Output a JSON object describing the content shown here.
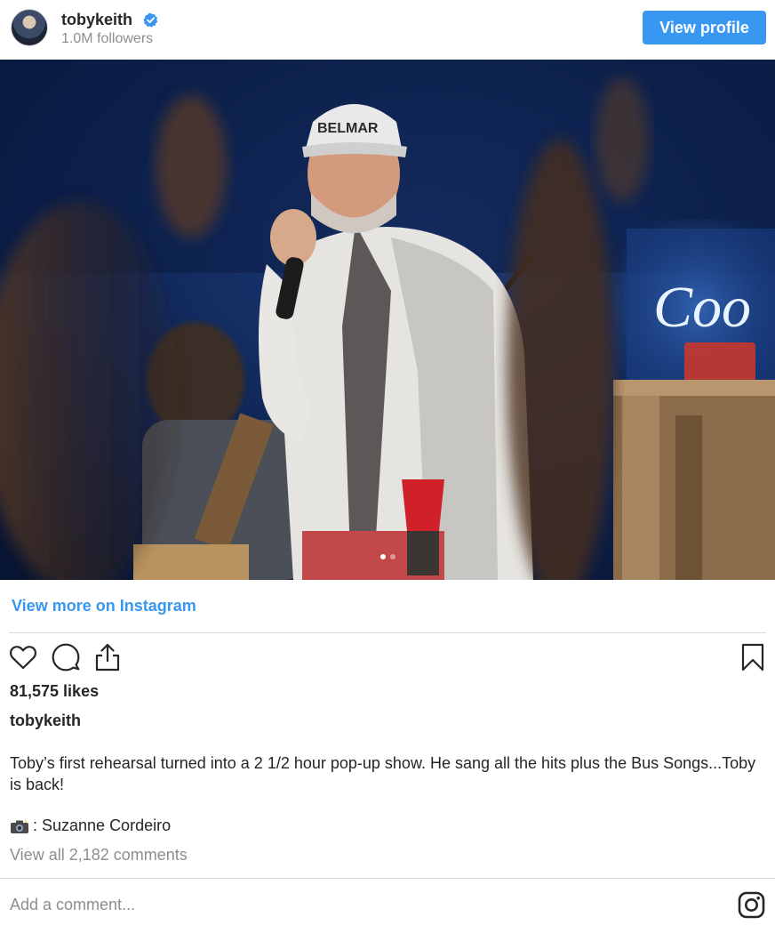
{
  "header": {
    "username": "tobykeith",
    "followers": "1.0M followers",
    "view_profile_label": "View profile",
    "verified": true
  },
  "photo": {
    "sign_text": "Coo",
    "cap_text": "BELMAR",
    "carousel_count": 2,
    "carousel_active": 1
  },
  "links": {
    "view_more": "View more on Instagram"
  },
  "post": {
    "likes": "81,575 likes",
    "caption_user": "tobykeith",
    "caption_text": "Toby’s first rehearsal turned into a 2 1/2 hour pop-up show. He sang all the hits plus the Bus Songs...Toby is back!",
    "credit_text": ": Suzanne Cordeiro",
    "view_comments": "View all 2,182 comments"
  },
  "comment_box": {
    "placeholder": "Add a comment..."
  },
  "icons": {
    "like": "heart-icon",
    "comment": "comment-bubble-icon",
    "share": "share-icon",
    "save": "bookmark-icon",
    "verified": "verified-badge-icon",
    "credit": "camera-flash-icon",
    "brand": "instagram-logo-icon"
  },
  "colors": {
    "accent": "#3897f0",
    "text": "#262626",
    "muted": "#8e8e8e",
    "divider": "#dbdbdb"
  }
}
